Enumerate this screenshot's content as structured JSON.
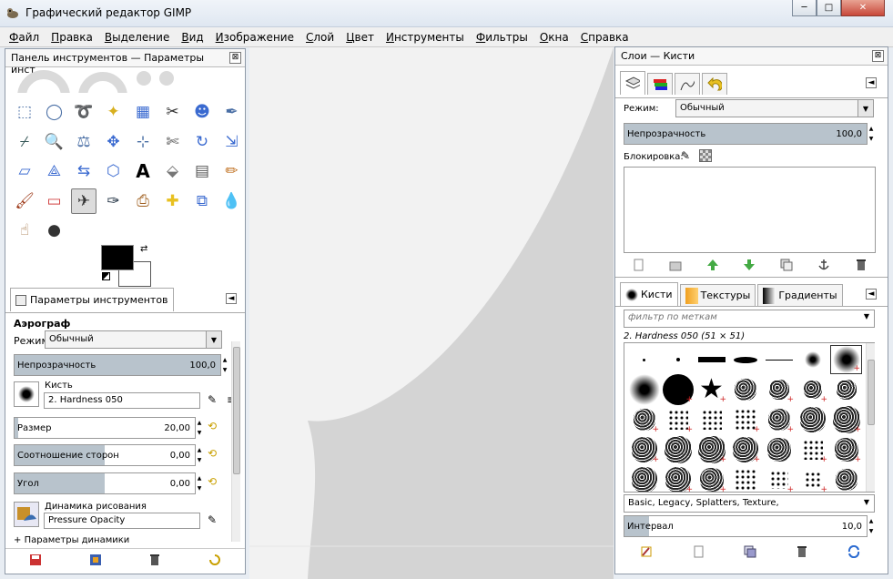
{
  "window": {
    "title": "Графический редактор GIMP",
    "controls": {
      "minimize": "─",
      "maximize": "□",
      "close": "✕"
    }
  },
  "menubar": {
    "items": [
      {
        "label": "Файл",
        "accel": "Ф",
        "rest": "айл"
      },
      {
        "label": "Правка",
        "accel": "П",
        "rest": "равка"
      },
      {
        "label": "Выделение",
        "accel": "В",
        "rest": "ыделение"
      },
      {
        "label": "Вид",
        "accel": "В",
        "rest": "ид"
      },
      {
        "label": "Изображение",
        "accel": "И",
        "rest": "зображение"
      },
      {
        "label": "Слой",
        "accel": "С",
        "rest": "лой"
      },
      {
        "label": "Цвет",
        "accel": "Ц",
        "rest": "вет"
      },
      {
        "label": "Инструменты",
        "accel": "И",
        "rest": "нструменты"
      },
      {
        "label": "Фильтры",
        "accel": "Ф",
        "rest": "ильтры"
      },
      {
        "label": "Окна",
        "accel": "О",
        "rest": "кна"
      },
      {
        "label": "Справка",
        "accel": "С",
        "rest": "правка"
      }
    ]
  },
  "toolbox": {
    "title": "Панель инструментов — Параметры инст...",
    "close": "⊠",
    "tabs": {
      "tool_options": "Параметры инструментов",
      "menu": "◄"
    },
    "tool_name": "Аэрограф",
    "mode": {
      "label": "Режим:",
      "value": "Обычный"
    },
    "opacity": {
      "label": "Непрозрачность",
      "value": "100,0",
      "fraction": 1.0
    },
    "brush": {
      "label": "Кисть",
      "value": "2. Hardness 050"
    },
    "size": {
      "label": "Размер",
      "value": "20,00",
      "fraction": 0.02
    },
    "aspect": {
      "label": "Соотношение сторон",
      "value": "0,00",
      "fraction": 0.5
    },
    "angle": {
      "label": "Угол",
      "value": "0,00",
      "fraction": 0.5
    },
    "dynamics": {
      "label": "Динамика рисования",
      "value": "Pressure Opacity"
    },
    "dynamics_params": "Параметры динамики",
    "expander": "+"
  },
  "layers": {
    "title": "Слои — Кисти",
    "close": "⊠",
    "menu": "◄",
    "mode": {
      "label": "Режим:",
      "value": "Обычный"
    },
    "opacity": {
      "label": "Непрозрачность",
      "value": "100,0",
      "fraction": 1.0
    },
    "lock_label": "Блокировка:"
  },
  "brushes": {
    "tabs": [
      "Кисти",
      "Текстуры",
      "Градиенты"
    ],
    "filter_placeholder": "фильтр по меткам",
    "current": "2. Hardness 050 (51 × 51)",
    "tags": "Basic, Legacy, Splatters, Texture,",
    "spacing": {
      "label": "Интервал",
      "value": "10,0",
      "fraction": 0.1
    },
    "menu": "◄"
  },
  "colors": {
    "accent_fill": "#b8c3cc",
    "canvas_bg": "#f2f2f2",
    "canvas_shape": "#d4d4d4"
  }
}
